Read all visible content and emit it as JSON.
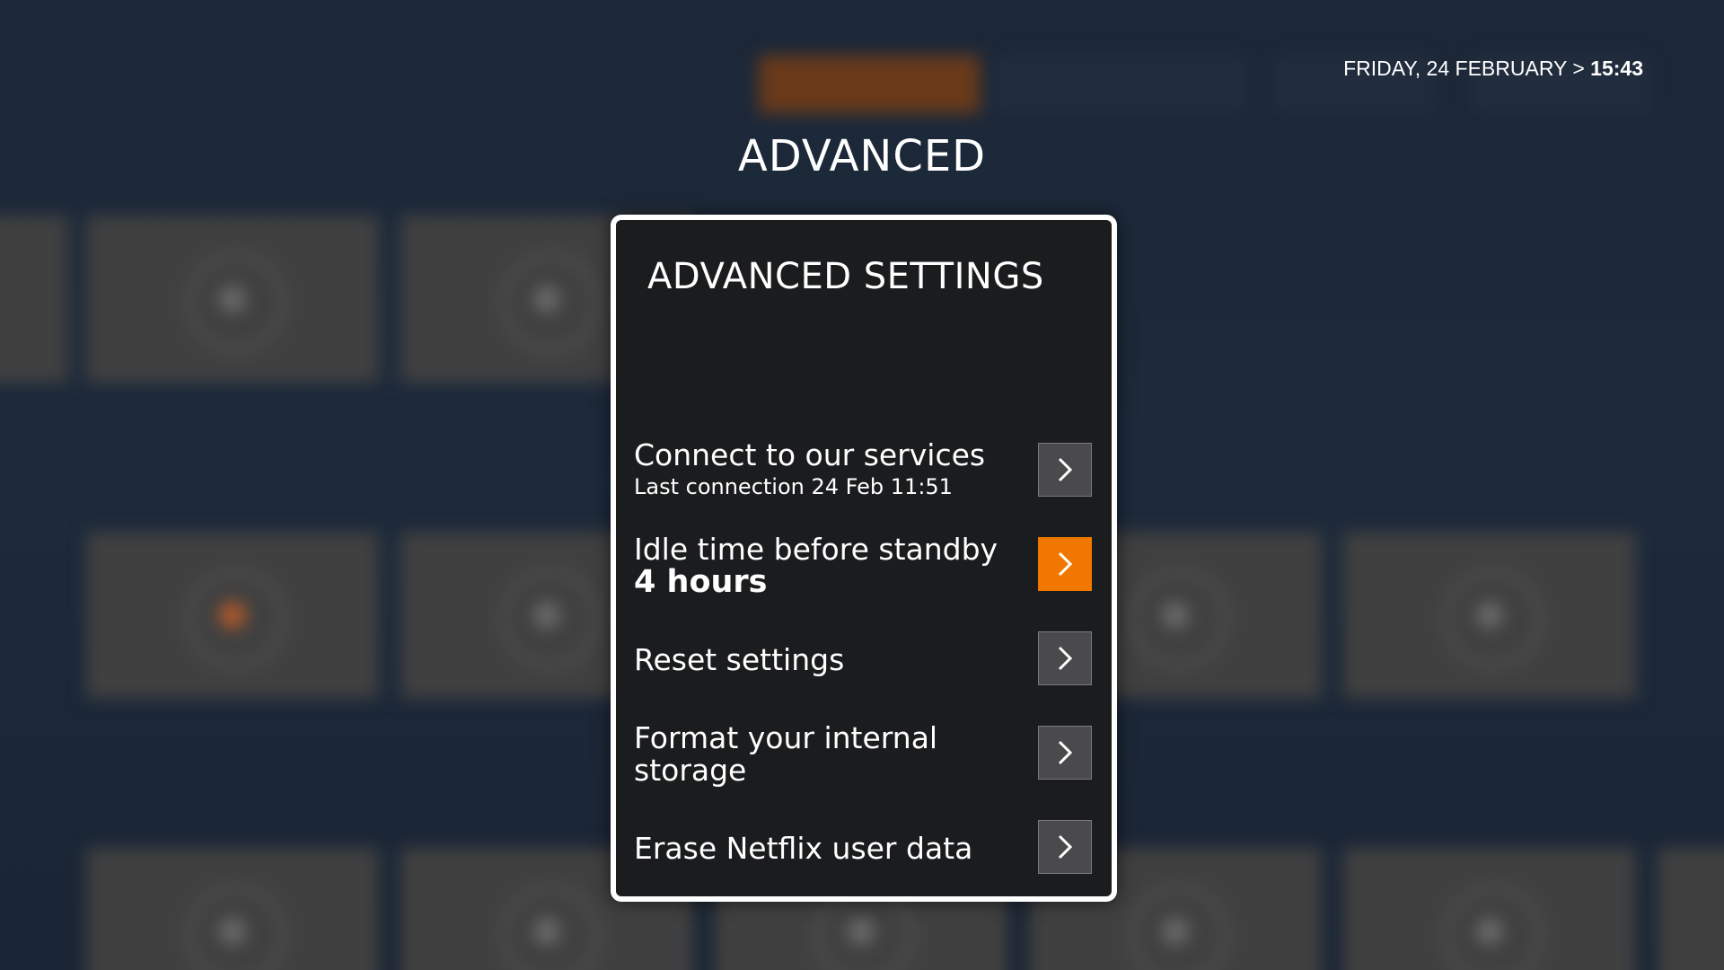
{
  "header": {
    "date": "FRIDAY, 24 FEBRUARY",
    "separator": ">",
    "time": "15:43",
    "page_title": "ADVANCED"
  },
  "dialog": {
    "title": "ADVANCED SETTINGS",
    "items": [
      {
        "label": "Connect to our services",
        "sublabel": "Last connection 24 Feb 11:51",
        "focused": false,
        "icon": "chevron-right-icon"
      },
      {
        "label": "Idle time before standby",
        "value": "4 hours",
        "focused": true,
        "icon": "chevron-right-icon"
      },
      {
        "label": "Reset settings",
        "focused": false,
        "icon": "chevron-right-icon"
      },
      {
        "label": "Format your internal storage",
        "focused": false,
        "icon": "chevron-right-icon"
      },
      {
        "label": "Erase Netflix user data",
        "focused": false,
        "icon": "chevron-right-icon"
      }
    ]
  },
  "colors": {
    "focus_accent": "#f07800",
    "dialog_background": "#1b1c1e",
    "screen_background": "#1c2838"
  }
}
